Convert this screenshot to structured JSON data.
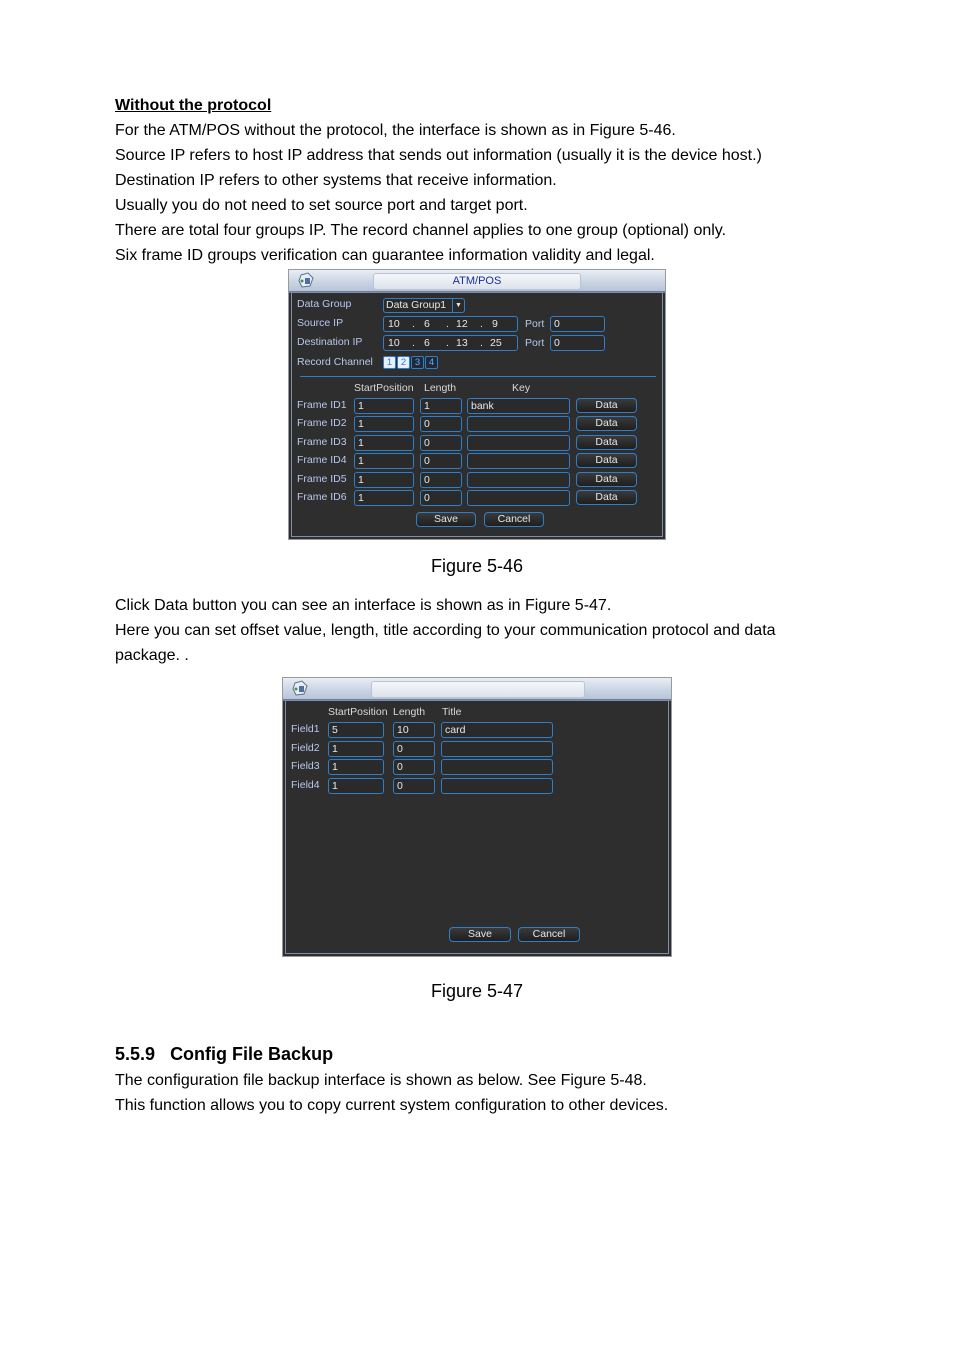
{
  "intro": {
    "heading": "Without the protocol",
    "lines": [
      "For the ATM/POS without the protocol, the interface is shown as in Figure 5-46.",
      "Source IP refers to host IP address that sends out information (usually it is the device host.)",
      "Destination IP refers to other systems that receive information.",
      "Usually you do not need to set source port and target port.",
      "There are total four groups IP. The record channel applies to one group (optional) only.",
      "Six frame ID groups verification can guarantee information validity and legal."
    ]
  },
  "figure46": {
    "title": "ATM/POS",
    "caption": "Figure 5-46",
    "data_group_label": "Data Group",
    "data_group_value": "Data Group1",
    "source_ip_label": "Source IP",
    "source_ip": [
      "10",
      "6",
      "12",
      "9"
    ],
    "source_port_label": "Port",
    "source_port": "0",
    "dest_ip_label": "Destination IP",
    "dest_ip": [
      "10",
      "6",
      "13",
      "25"
    ],
    "dest_port_label": "Port",
    "dest_port": "0",
    "record_channel_label": "Record Channel",
    "channels": [
      {
        "num": "1",
        "checked": true
      },
      {
        "num": "2",
        "checked": true
      },
      {
        "num": "3",
        "checked": false
      },
      {
        "num": "4",
        "checked": false
      }
    ],
    "columns": {
      "start": "StartPosition",
      "length": "Length",
      "key": "Key"
    },
    "rows": [
      {
        "label": "Frame ID1",
        "start": "1",
        "length": "1",
        "key": "bank",
        "button": "Data"
      },
      {
        "label": "Frame ID2",
        "start": "1",
        "length": "0",
        "key": "",
        "button": "Data"
      },
      {
        "label": "Frame ID3",
        "start": "1",
        "length": "0",
        "key": "",
        "button": "Data"
      },
      {
        "label": "Frame ID4",
        "start": "1",
        "length": "0",
        "key": "",
        "button": "Data"
      },
      {
        "label": "Frame ID5",
        "start": "1",
        "length": "0",
        "key": "",
        "button": "Data"
      },
      {
        "label": "Frame ID6",
        "start": "1",
        "length": "0",
        "key": "",
        "button": "Data"
      }
    ],
    "save_label": "Save",
    "cancel_label": "Cancel"
  },
  "middle": {
    "lines": [
      "Click Data button you can see an interface is shown as in Figure 5-47.",
      "Here you can set offset value, length, title according to your communication protocol and data",
      "package. ."
    ]
  },
  "figure47": {
    "caption": "Figure 5-47",
    "columns": {
      "start": "StartPosition",
      "length": "Length",
      "title": "Title"
    },
    "rows": [
      {
        "label": "Field1",
        "start": "5",
        "length": "10",
        "title": "card"
      },
      {
        "label": "Field2",
        "start": "1",
        "length": "0",
        "title": ""
      },
      {
        "label": "Field3",
        "start": "1",
        "length": "0",
        "title": ""
      },
      {
        "label": "Field4",
        "start": "1",
        "length": "0",
        "title": ""
      }
    ],
    "save_label": "Save",
    "cancel_label": "Cancel"
  },
  "section": {
    "number": "5.5.9",
    "title": "Config File Backup",
    "lines": [
      "The configuration file backup interface is shown as below. See Figure 5-48.",
      "This function allows you to copy current system configuration to other devices."
    ]
  }
}
